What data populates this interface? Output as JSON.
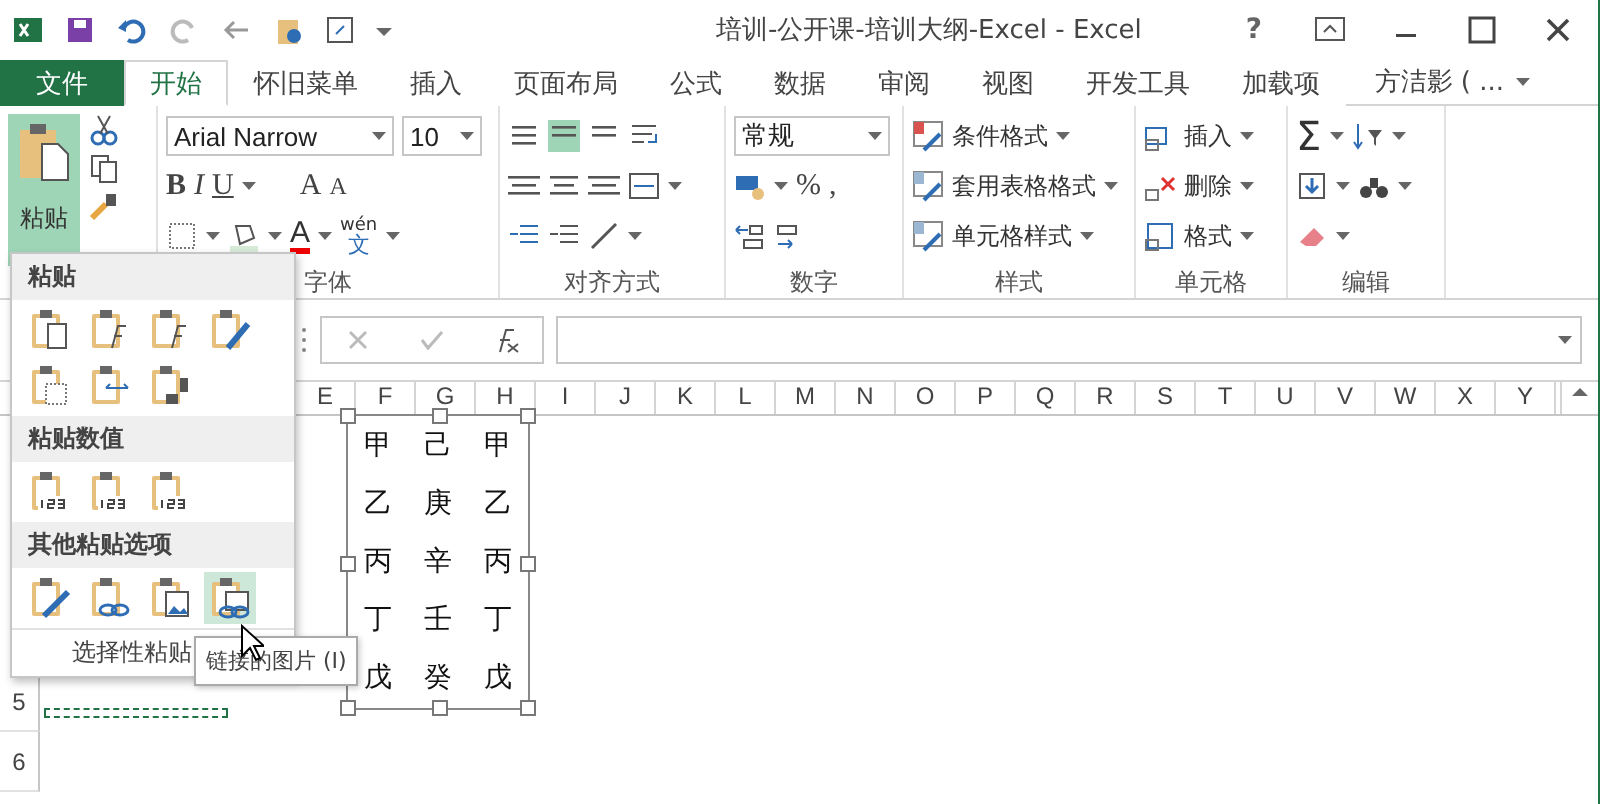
{
  "title_bar": {
    "title": "培训-公开课-培训大纲-Excel - Excel",
    "help": "?"
  },
  "tabs": [
    {
      "label": "文件",
      "kind": "file",
      "selected": false
    },
    {
      "label": "开始",
      "kind": "tab",
      "selected": true
    },
    {
      "label": "怀旧菜单",
      "kind": "tab",
      "selected": false
    },
    {
      "label": "插入",
      "kind": "tab",
      "selected": false
    },
    {
      "label": "页面布局",
      "kind": "tab",
      "selected": false
    },
    {
      "label": "公式",
      "kind": "tab",
      "selected": false
    },
    {
      "label": "数据",
      "kind": "tab",
      "selected": false
    },
    {
      "label": "审阅",
      "kind": "tab",
      "selected": false
    },
    {
      "label": "视图",
      "kind": "tab",
      "selected": false
    },
    {
      "label": "开发工具",
      "kind": "tab",
      "selected": false
    },
    {
      "label": "加载项",
      "kind": "tab",
      "selected": false
    }
  ],
  "account": "方洁影 ( ...",
  "ribbon": {
    "paste_label": "粘贴",
    "font_name": "Arial Narrow",
    "font_size": "10",
    "font_buttons": [
      {
        "kind": "bold",
        "label": "B"
      },
      {
        "kind": "italic",
        "label": "I"
      },
      {
        "kind": "underline",
        "label": "U"
      },
      {
        "kind": "grow",
        "label": "A"
      },
      {
        "kind": "shrink",
        "label": "A"
      }
    ],
    "font_color": "A",
    "phonetic_top": "wén",
    "phonetic_bottom": "文",
    "number_format": "常规",
    "number_buttons": [
      "%",
      ","
    ],
    "styles": [
      "条件格式",
      "套用表格格式",
      "单元格样式"
    ],
    "cells": [
      "插入",
      "删除",
      "格式"
    ],
    "sum": "Σ",
    "group_labels": [
      "字体",
      "对齐方式",
      "数字",
      "样式",
      "单元格",
      "编辑"
    ]
  },
  "paste_menu": {
    "sections": [
      {
        "title": "粘贴",
        "options": [
          {
            "kind": "paste",
            "selected": false
          },
          {
            "kind": "formula",
            "selected": false
          },
          {
            "kind": "formula-number",
            "selected": false
          },
          {
            "kind": "keep-format",
            "selected": false
          },
          {
            "kind": "no-border",
            "selected": false
          },
          {
            "kind": "col-width",
            "selected": false
          },
          {
            "kind": "transpose",
            "selected": false
          }
        ]
      },
      {
        "title": "粘贴数值",
        "options": [
          {
            "kind": "values",
            "selected": false
          },
          {
            "kind": "values-number",
            "selected": false
          },
          {
            "kind": "values-format",
            "selected": false
          }
        ]
      },
      {
        "title": "其他粘贴选项",
        "options": [
          {
            "kind": "format",
            "selected": false
          },
          {
            "kind": "link",
            "selected": false
          },
          {
            "kind": "picture",
            "selected": false
          },
          {
            "kind": "linked-picture",
            "selected": true
          }
        ]
      }
    ],
    "footer": "选择性粘贴"
  },
  "tooltip": "链接的图片 (I)",
  "columns": [
    "E",
    "F",
    "G",
    "H",
    "I",
    "J",
    "K",
    "L",
    "M",
    "N",
    "O",
    "P",
    "Q",
    "R",
    "S",
    "T",
    "U",
    "V",
    "W",
    "X",
    "Y"
  ],
  "rows": [
    "5",
    "6"
  ],
  "linked_picture": [
    [
      "甲",
      "己",
      "甲"
    ],
    [
      "乙",
      "庚",
      "乙"
    ],
    [
      "丙",
      "辛",
      "丙"
    ],
    [
      "丁",
      "壬",
      "丁"
    ],
    [
      "戊",
      "癸",
      "戊"
    ]
  ]
}
